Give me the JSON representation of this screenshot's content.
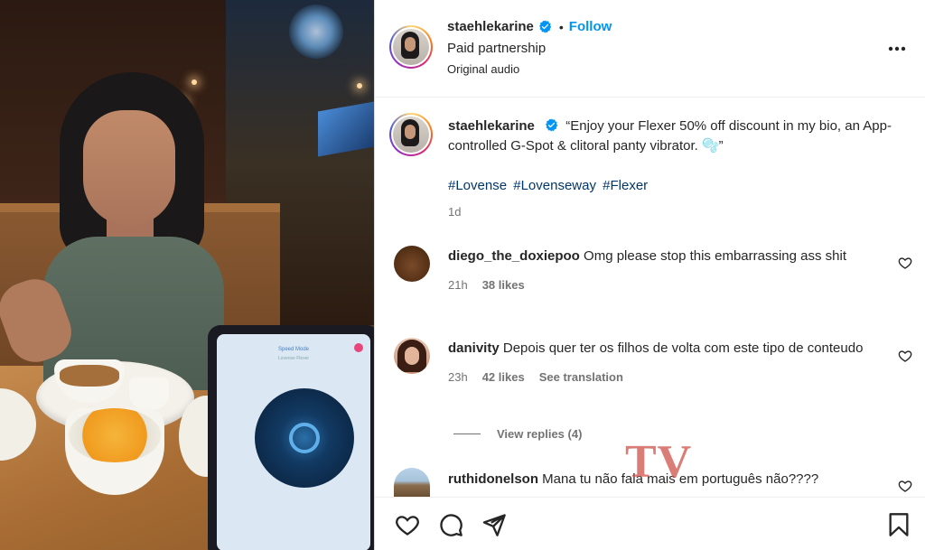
{
  "post": {
    "username": "staehlekarine",
    "follow_label": "Follow",
    "separator": "•",
    "paid_partnership": "Paid partnership",
    "audio": "Original audio"
  },
  "caption": {
    "username": "staehlekarine",
    "text": "“Enjoy your Flexer 50% off discount in my bio, an App-controlled G-Spot & clitoral panty vibrator. 🫧”",
    "hashtags": [
      "#Lovense",
      "#Lovenseway",
      "#Flexer"
    ],
    "time": "1d"
  },
  "comments": [
    {
      "username": "diego_the_doxiepoo",
      "text": "Omg please stop this embarrassing ass shit",
      "time": "21h",
      "likes": "38 likes"
    },
    {
      "username": "danivity",
      "text": "Depois quer ter os filhos de volta com este tipo de conteudo",
      "time": "23h",
      "likes": "42 likes",
      "translate": "See translation",
      "view_replies": "View replies (4)"
    },
    {
      "username": "ruthidonelson",
      "text": "Mana tu não fala mais em português não????"
    }
  ],
  "media": {
    "phone_title": "Speed Mode",
    "phone_subtitle": "Lovense Flexer"
  },
  "watermark": "TV",
  "colors": {
    "follow": "#0095f6",
    "hashtag": "#00376b",
    "verified": "#0095f6",
    "muted": "#737373",
    "watermark": "#cf524a"
  },
  "icons": [
    "verified-badge-icon",
    "more-options-icon",
    "heart-icon",
    "comment-icon",
    "share-icon",
    "bookmark-icon"
  ]
}
